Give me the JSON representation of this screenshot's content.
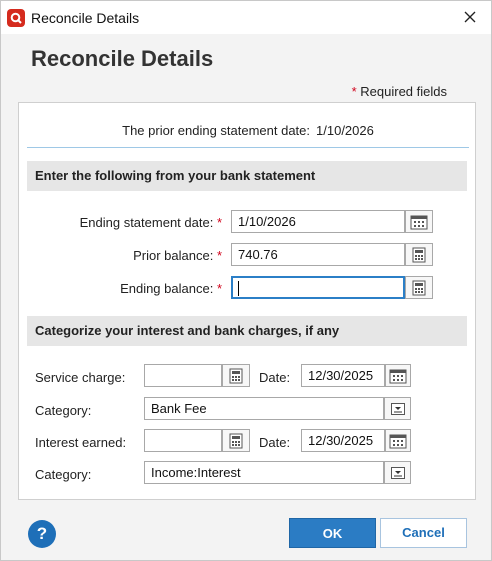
{
  "window": {
    "title": "Reconcile Details"
  },
  "heading": "Reconcile Details",
  "required_note": {
    "star": "*",
    "text": "Required fields"
  },
  "prior": {
    "label": "The prior ending statement date:",
    "value": "1/10/2026"
  },
  "bank_section": {
    "title": "Enter the following from your bank statement",
    "ending_date": {
      "label": "Ending statement date:",
      "value": "1/10/2026"
    },
    "prior_balance": {
      "label": "Prior balance:",
      "value": "740.76"
    },
    "ending_balance": {
      "label": "Ending balance:",
      "value": ""
    }
  },
  "charges_section": {
    "title": "Categorize your interest and bank charges, if any",
    "service_charge": {
      "label": "Service charge:",
      "value": ""
    },
    "service_date": {
      "label": "Date:",
      "value": "12/30/2025"
    },
    "service_category": {
      "label": "Category:",
      "value": "Bank Fee"
    },
    "interest_earned": {
      "label": "Interest earned:",
      "value": ""
    },
    "interest_date": {
      "label": "Date:",
      "value": "12/30/2025"
    },
    "interest_category": {
      "label": "Category:",
      "value": "Income:Interest"
    }
  },
  "buttons": {
    "help": "?",
    "ok": "OK",
    "cancel": "Cancel"
  },
  "colors": {
    "brand_red": "#d52b1e",
    "primary_blue": "#2b7cc4",
    "required_red": "#d0021b"
  }
}
